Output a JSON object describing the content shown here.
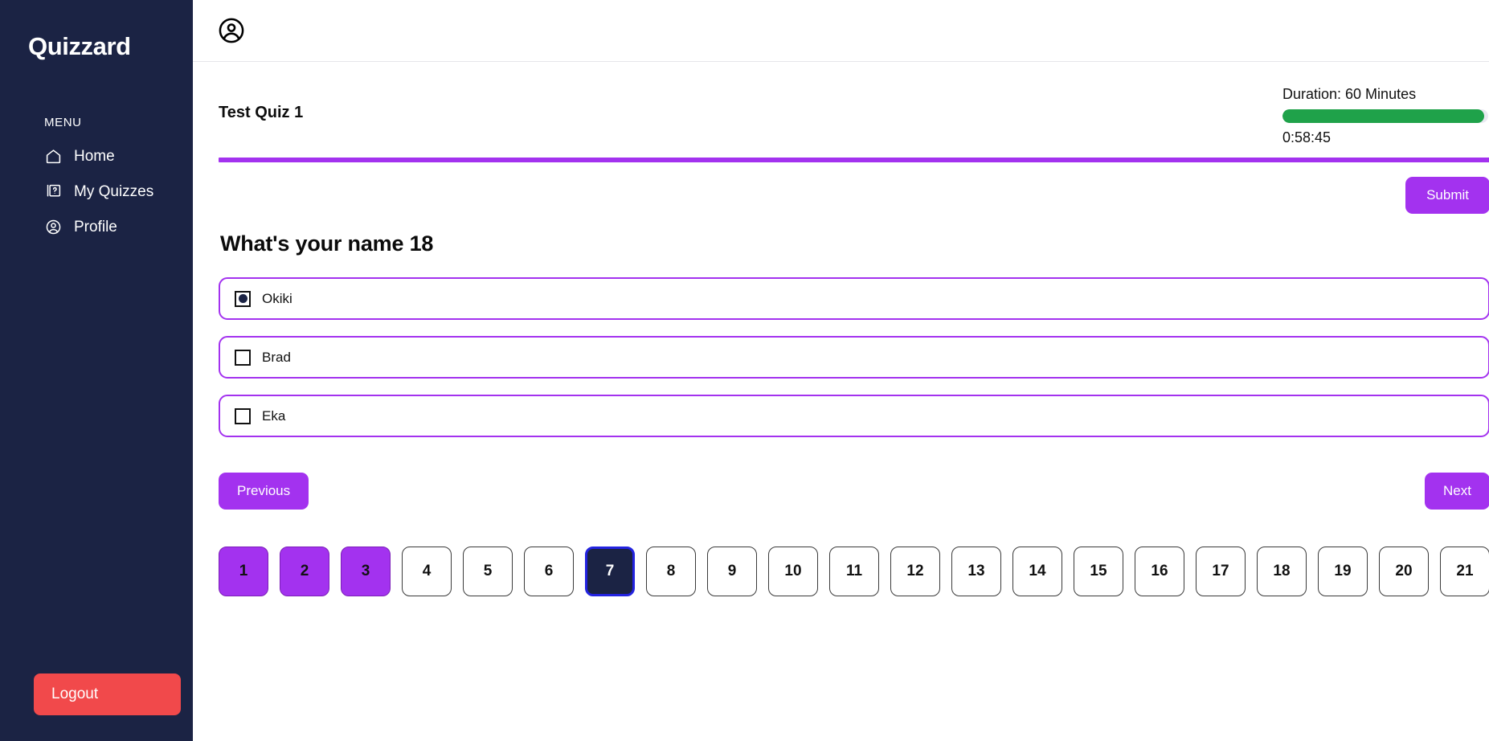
{
  "sidebar": {
    "brand": "Quizzard",
    "menu_label": "MENU",
    "items": [
      {
        "label": "Home",
        "icon": "home-icon"
      },
      {
        "label": "My Quizzes",
        "icon": "quiz-card-icon"
      },
      {
        "label": "Profile",
        "icon": "user-circle-icon"
      }
    ],
    "logout_label": "Logout",
    "bg_color": "#1b2344",
    "logout_color": "#f1494b"
  },
  "topbar": {
    "avatar_icon": "user-circle-icon"
  },
  "quiz": {
    "title": "Test Quiz 1",
    "duration_text": "Duration: 60 Minutes",
    "time_remaining": "0:58:45",
    "progress_percent": 98,
    "progress_color": "#1fa24a",
    "accent_color": "#a332ef",
    "submit_label": "Submit",
    "question": "What's your name 18",
    "options": [
      {
        "label": "Okiki",
        "checked": true
      },
      {
        "label": "Brad",
        "checked": false
      },
      {
        "label": "Eka",
        "checked": false
      }
    ],
    "previous_label": "Previous",
    "next_label": "Next",
    "pagination": [
      {
        "number": "1",
        "state": "answered"
      },
      {
        "number": "2",
        "state": "answered"
      },
      {
        "number": "3",
        "state": "answered"
      },
      {
        "number": "4",
        "state": "default"
      },
      {
        "number": "5",
        "state": "default"
      },
      {
        "number": "6",
        "state": "default"
      },
      {
        "number": "7",
        "state": "current"
      },
      {
        "number": "8",
        "state": "default"
      },
      {
        "number": "9",
        "state": "default"
      },
      {
        "number": "10",
        "state": "default"
      },
      {
        "number": "11",
        "state": "default"
      },
      {
        "number": "12",
        "state": "default"
      },
      {
        "number": "13",
        "state": "default"
      },
      {
        "number": "14",
        "state": "default"
      },
      {
        "number": "15",
        "state": "default"
      },
      {
        "number": "16",
        "state": "default"
      },
      {
        "number": "17",
        "state": "default"
      },
      {
        "number": "18",
        "state": "default"
      },
      {
        "number": "19",
        "state": "default"
      },
      {
        "number": "20",
        "state": "default"
      },
      {
        "number": "21",
        "state": "default"
      }
    ]
  }
}
